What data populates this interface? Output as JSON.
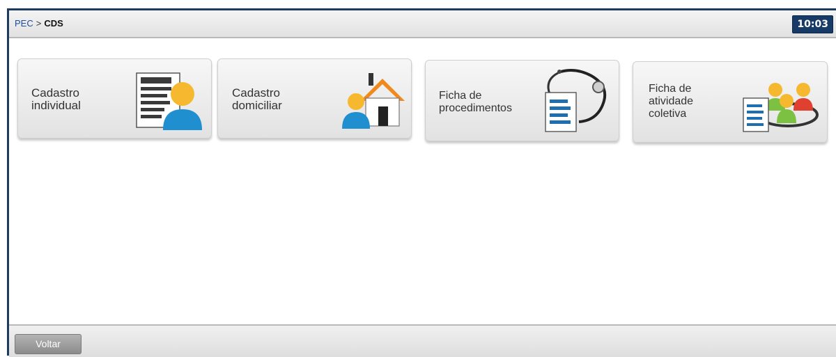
{
  "header": {
    "breadcrumb": {
      "root": "PEC",
      "separator": ">",
      "current": "CDS"
    },
    "clock": "10:03"
  },
  "tiles": [
    {
      "label": "Cadastro\nindividual",
      "icon": "person-record-icon"
    },
    {
      "label": "Cadastro\ndomiciliar",
      "icon": "house-person-icon"
    },
    {
      "label": "Ficha de\nprocedimentos",
      "icon": "stethoscope-document-icon"
    },
    {
      "label": "Ficha de\natividade\ncoletiva",
      "icon": "group-document-icon"
    }
  ],
  "footer": {
    "back_label": "Voltar"
  },
  "colors": {
    "frame": "#1f3a5f",
    "clock_bg": "#173a66",
    "breadcrumb_link": "#1e4b9b",
    "person_blue": "#1f8fd0",
    "person_head": "#f5b82e",
    "roof_orange": "#f08a1c",
    "person_green": "#7cc142",
    "person_red": "#e0402f"
  }
}
